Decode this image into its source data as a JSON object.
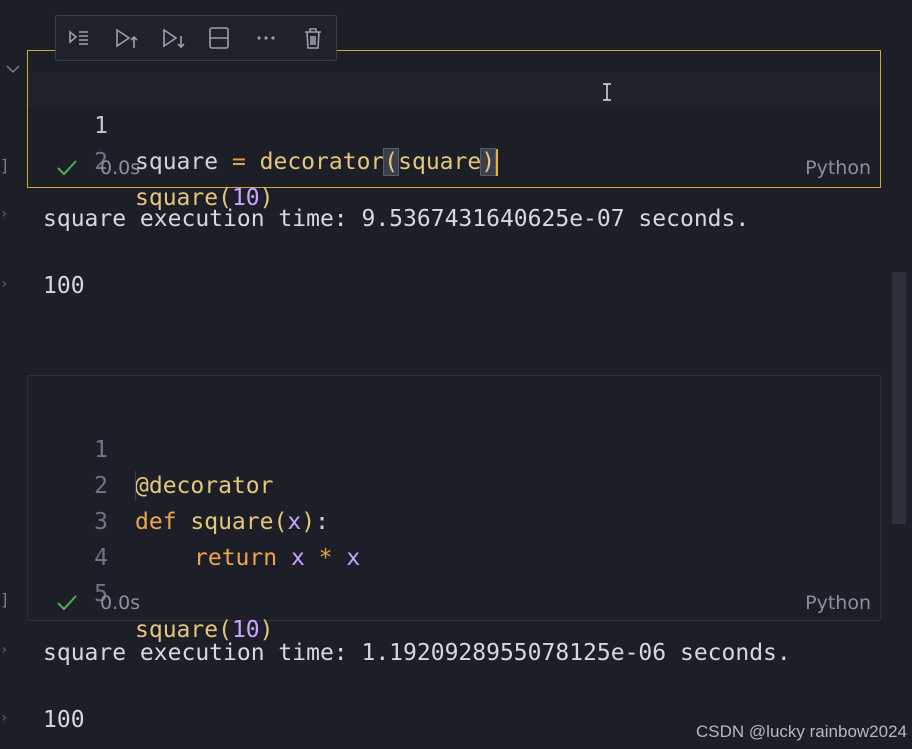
{
  "toolbar": {
    "icons": [
      "execute-above-icon",
      "run-above-icon",
      "run-below-icon",
      "split-cell-icon",
      "more-actions-icon",
      "delete-icon"
    ]
  },
  "cell1": {
    "line_numbers": [
      "1",
      "2"
    ],
    "line1": {
      "a": "square",
      "eq": " = ",
      "fn": "decorator",
      "lp": "(",
      "arg": "square",
      "rp": ")"
    },
    "line2": {
      "fn": "square",
      "lp": "(",
      "num": "10",
      "rp": ")"
    },
    "status": {
      "time": "0.0s",
      "language": "Python"
    },
    "output": [
      "square execution time: 9.5367431640625e-07 seconds.",
      "100"
    ]
  },
  "cell2": {
    "line_numbers": [
      "1",
      "2",
      "3",
      "4",
      "5"
    ],
    "line1": {
      "decorator": "@decorator"
    },
    "line2": {
      "kw": "def",
      "fn": " square",
      "lp": "(",
      "param": "x",
      "rp": ")",
      "colon": ":"
    },
    "line3": {
      "kw": "return",
      "x1": " x",
      "op": " * ",
      "x2": "x"
    },
    "line5": {
      "fn": "square",
      "lp": "(",
      "num": "10",
      "rp": ")"
    },
    "status": {
      "time": "0.0s",
      "language": "Python"
    },
    "output": [
      "square execution time: 1.1920928955078125e-06 seconds.",
      "100"
    ]
  },
  "watermark": "CSDN @lucky rainbow2024",
  "colors": {
    "focus_border": "#d6a538",
    "success_check": "#4caf50",
    "background": "#1c1f27"
  }
}
